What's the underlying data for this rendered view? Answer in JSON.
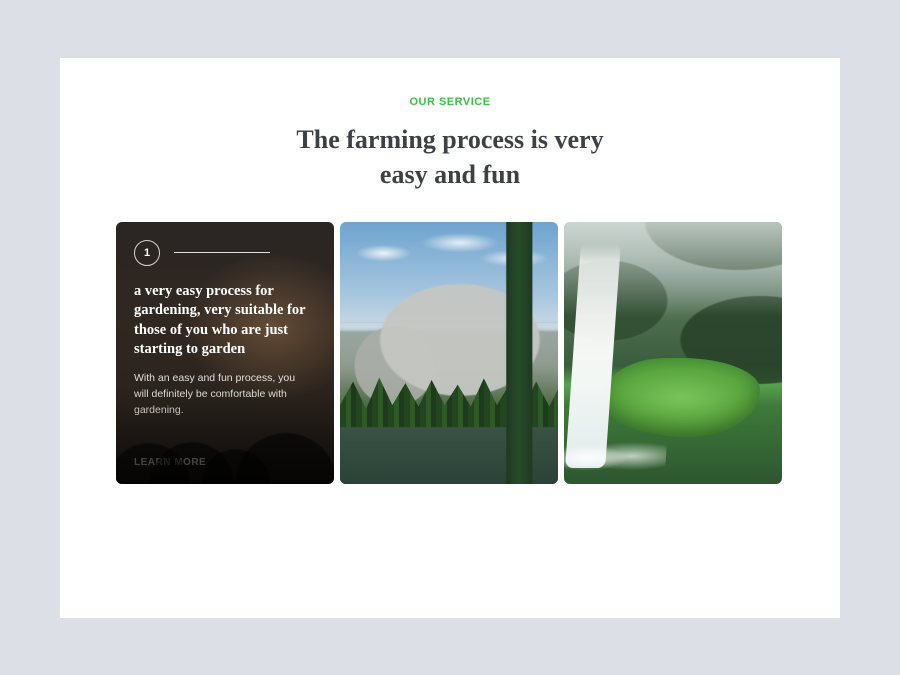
{
  "header": {
    "eyebrow": "OUR SERVICE",
    "title": "The farming process is very easy and fun"
  },
  "cards": [
    {
      "step": "1",
      "title": "a very easy process for gardening, very suitable for those of you who are just starting to garden",
      "description": "With an easy and fun process, you will definitely be comfortable with gardening.",
      "cta": "LEARN MORE"
    }
  ],
  "colors": {
    "accent": "#3fbf4a",
    "heading": "#3d4146"
  }
}
